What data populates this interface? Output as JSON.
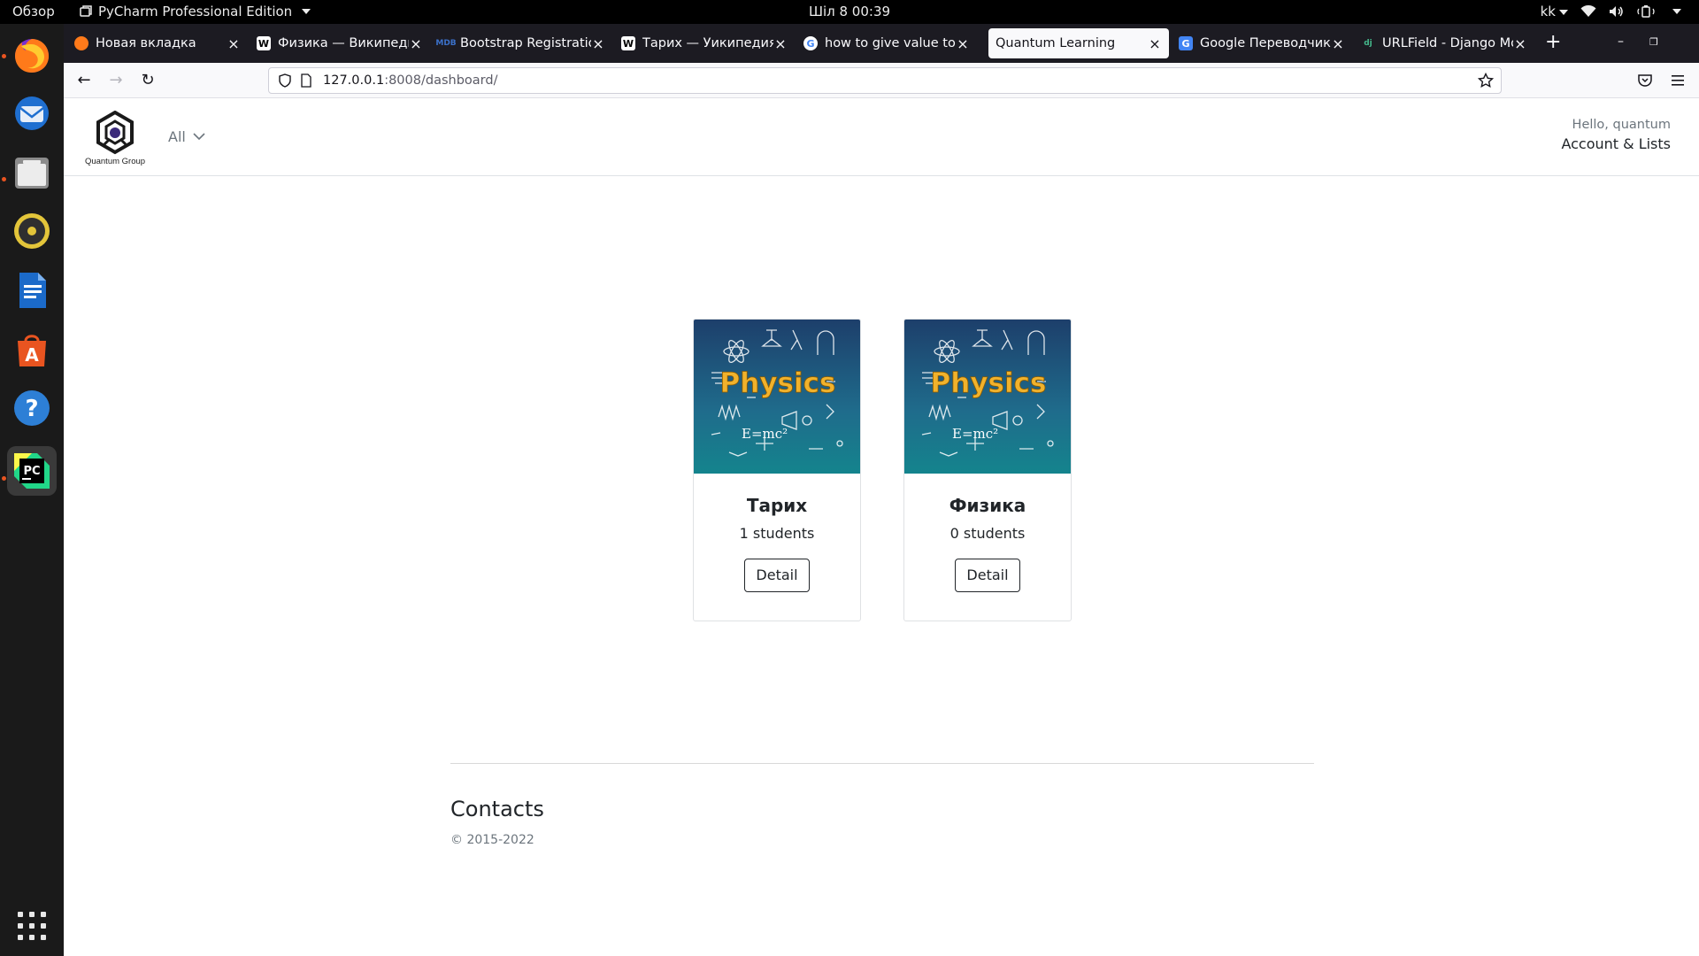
{
  "system": {
    "activities": "Обзор",
    "app_name": "PyCharm Professional Edition",
    "clock": "Шіл 8  00:39",
    "input_lang": "kk"
  },
  "dock": {
    "items": [
      "firefox-icon",
      "thunderbird-icon",
      "files-icon",
      "rhythmbox-icon",
      "libreoffice-writer-icon",
      "software-center-icon",
      "help-icon",
      "pycharm-icon"
    ],
    "show_apps": "show-applications-icon"
  },
  "browser": {
    "tabs": [
      {
        "title": "Новая вкладка",
        "icon": "firefox-icon",
        "active": false
      },
      {
        "title": "Физика — Википедия",
        "icon": "wikipedia-icon",
        "active": false
      },
      {
        "title": "Bootstrap Registration",
        "icon": "mdb-icon",
        "active": false
      },
      {
        "title": "Тарих — Уикипедия",
        "icon": "wikipedia-icon",
        "active": false
      },
      {
        "title": "how to give value to Im",
        "icon": "google-icon",
        "active": false
      },
      {
        "title": "Quantum Learning",
        "icon": "none",
        "active": true
      },
      {
        "title": "Google Переводчик",
        "icon": "google-translate-icon",
        "active": false
      },
      {
        "title": "URLField - Django Mod",
        "icon": "django-icon",
        "active": false
      }
    ],
    "url_host": "127.0.0.1",
    "url_path": ":8008/dashboard/"
  },
  "site": {
    "logo_text": "Quantum Group",
    "category_menu": "All",
    "greeting": "Hello, quantum",
    "account_link": "Account & Lists"
  },
  "courses": [
    {
      "name": "Тарих",
      "students": "1 students",
      "button": "Detail",
      "image_text": "Physics"
    },
    {
      "name": "Физика",
      "students": "0 students",
      "button": "Detail",
      "image_text": "Physics"
    }
  ],
  "footer": {
    "title": "Contacts",
    "copyright": "© 2015-2022"
  }
}
